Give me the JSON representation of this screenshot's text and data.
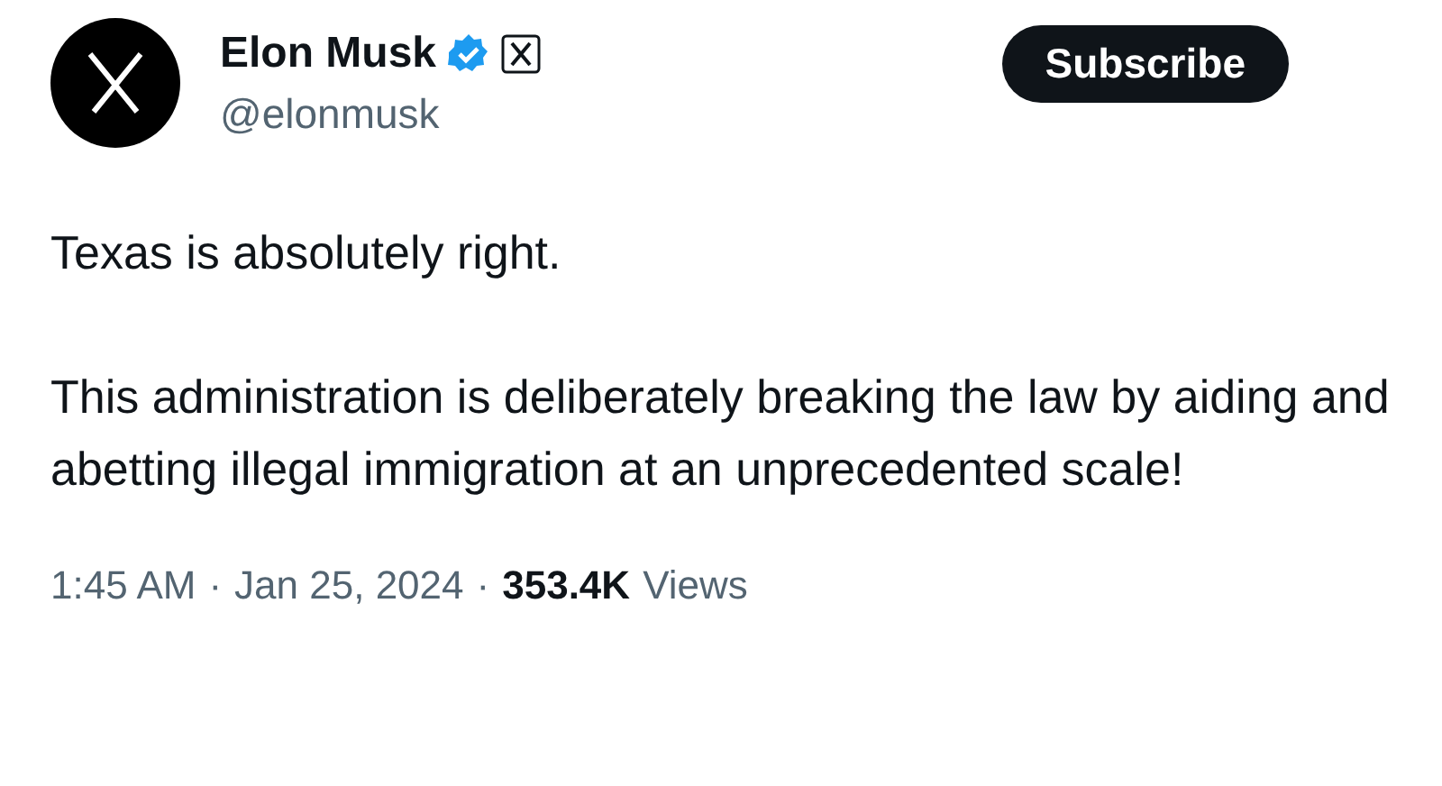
{
  "author": {
    "name": "Elon Musk",
    "handle": "@elonmusk",
    "verified": true,
    "affiliate_badge": true
  },
  "subscribe_button": "Subscribe",
  "paragraphs": [
    "Texas is absolutely right.",
    "This administration is deliberately breaking the law by aiding and abetting illegal immigration at an unprecedented scale!"
  ],
  "meta": {
    "time": "1:45 AM",
    "separator": "·",
    "date": "Jan 25, 2024",
    "views_count": "353.4K",
    "views_label": "Views"
  }
}
